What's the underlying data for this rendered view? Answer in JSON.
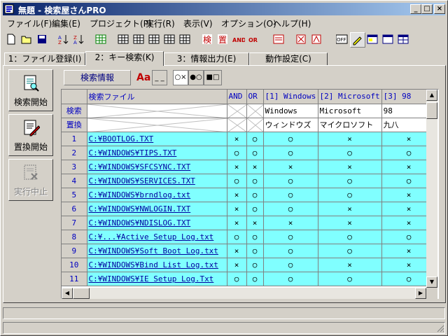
{
  "window": {
    "title": "無題 - 検索屋さんPRO"
  },
  "title_buttons": {
    "minimize": "_",
    "maximize": "□",
    "close": "×"
  },
  "menu": [
    "ファイル(F)",
    "編集(E)",
    "プロジェクト(P)",
    "実行(R)",
    "表示(V)",
    "オプション(O)",
    "ヘルプ(H)"
  ],
  "toolbar": {
    "and_label": "AND",
    "or_label": "OR",
    "off_label": "OFF"
  },
  "tabs": [
    "1：ファイル登録(I)",
    "2：キー検索(K)",
    "3：情報出力(E)",
    "動作設定(C)"
  ],
  "active_tab": 1,
  "side_buttons": {
    "search": "検索開始",
    "replace": "置換開始",
    "stop": "実行中止"
  },
  "options": {
    "search_info": "検索情報",
    "aa": "Aa",
    "blank": "_ _",
    "o1": "○×",
    "o2": "●○",
    "o3": "■□"
  },
  "grid": {
    "columns": [
      "検索ファイル",
      "AND",
      "OR",
      "[1] Windows",
      "[2] Microsoft",
      "[3] 98"
    ],
    "search_label": "検索",
    "replace_label": "置換",
    "search_keys": [
      "Windows",
      "Microsoft",
      "98"
    ],
    "replace_keys": [
      "ウィンドウズ",
      "マイクロソフト",
      "九八"
    ],
    "rows": [
      {
        "n": "1",
        "file": "C:¥BOOTLOG.TXT",
        "and": "×",
        "or": "○",
        "k1": "○",
        "k2": "×",
        "k3": "×"
      },
      {
        "n": "2",
        "file": "C:¥WINDOWS¥TIPS.TXT",
        "and": "○",
        "or": "○",
        "k1": "○",
        "k2": "○",
        "k3": "○"
      },
      {
        "n": "3",
        "file": "C:¥WINDOWS¥SFCSYNC.TXT",
        "and": "×",
        "or": "×",
        "k1": "×",
        "k2": "×",
        "k3": "×"
      },
      {
        "n": "4",
        "file": "C:¥WINDOWS¥SERVICES.TXT",
        "and": "○",
        "or": "○",
        "k1": "○",
        "k2": "○",
        "k3": "○"
      },
      {
        "n": "5",
        "file": "C:¥WINDOWS¥brndlog.txt",
        "and": "×",
        "or": "○",
        "k1": "○",
        "k2": "○",
        "k3": "×"
      },
      {
        "n": "6",
        "file": "C:¥WINDOWS¥NWLOGIN.TXT",
        "and": "×",
        "or": "○",
        "k1": "○",
        "k2": "×",
        "k3": "×"
      },
      {
        "n": "7",
        "file": "C:¥WINDOWS¥NDISLOG.TXT",
        "and": "×",
        "or": "×",
        "k1": "×",
        "k2": "×",
        "k3": "×"
      },
      {
        "n": "8",
        "file": "C:¥...¥Active Setup Log.txt",
        "and": "○",
        "or": "○",
        "k1": "○",
        "k2": "○",
        "k3": "○"
      },
      {
        "n": "9",
        "file": "C:¥WINDOWS¥Soft Boot Log.txt",
        "and": "×",
        "or": "○",
        "k1": "○",
        "k2": "○",
        "k3": "×"
      },
      {
        "n": "10",
        "file": "C:¥WINDOWS¥Bind List Log.txt",
        "and": "×",
        "or": "○",
        "k1": "○",
        "k2": "×",
        "k3": "×"
      },
      {
        "n": "11",
        "file": "C:¥WINDOWS¥IE Setup Log.Txt",
        "and": "○",
        "or": "○",
        "k1": "○",
        "k2": "○",
        "k3": "○"
      }
    ]
  },
  "colors": {
    "title_start": "#0a246a",
    "title_end": "#a6caf0",
    "row_bg": "#80ffff",
    "header_text": "#0000c0"
  }
}
